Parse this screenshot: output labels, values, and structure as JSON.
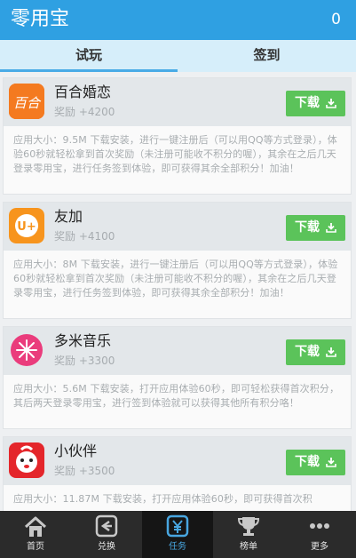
{
  "header": {
    "title": "零用宝",
    "count": "0"
  },
  "tabs": [
    {
      "label": "试玩"
    },
    {
      "label": "签到"
    }
  ],
  "apps": [
    {
      "name": "百合婚恋",
      "reward": "奖励 +4200",
      "button": "下载",
      "icon": "baihe-app-icon",
      "icon_text": "百合",
      "description": "应用大小：9.5M 下载安装，进行一键注册后（可以用QQ等方式登录），体验60秒就轻松拿到首次奖励（未注册可能收不积分的喔），其余在之后几天登录零用宝，进行任务签到体验，即可获得其余全部积分！加油！"
    },
    {
      "name": "友加",
      "reward": "奖励 +4100",
      "button": "下载",
      "icon": "youjia-app-icon",
      "icon_text": "U+",
      "description": "应用大小：8M 下载安装，进行一键注册后（可以用QQ等方式登录），体验60秒就轻松拿到首次奖励（未注册可能收不积分的喔），其余在之后几天登录零用宝，进行任务签到体验，即可获得其余全部积分！加油！"
    },
    {
      "name": "多米音乐",
      "reward": "奖励 +3300",
      "button": "下载",
      "icon": "duomi-music-app-icon",
      "description": "应用大小：5.6M 下载安装，打开应用体验60秒，即可轻松获得首次积分，其后两天登录零用宝，进行签到体验就可以获得其他所有积分咯！"
    },
    {
      "name": "小伙伴",
      "reward": "奖励 +3500",
      "button": "下载",
      "icon": "xiaohuoban-app-icon",
      "description": "应用大小：11.87M 下载安装，打开应用体验60秒，即可获得首次积"
    }
  ],
  "tabbar": [
    {
      "label": "首页",
      "icon": "home-icon"
    },
    {
      "label": "兑换",
      "icon": "exchange-icon"
    },
    {
      "label": "任务",
      "icon": "yuan-task-icon"
    },
    {
      "label": "榜单",
      "icon": "trophy-icon"
    },
    {
      "label": "更多",
      "icon": "more-dots-icon"
    }
  ],
  "colors": {
    "header": "#2fa0e2",
    "tab_bg": "#d6eefa",
    "download_button": "#5bc35a",
    "tabbar": "#2b2b2b",
    "active_tab_text": "#48a6e0"
  }
}
